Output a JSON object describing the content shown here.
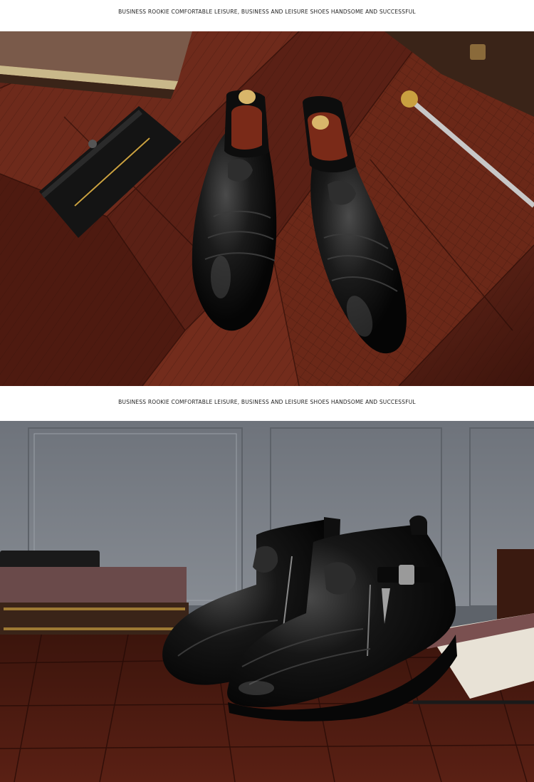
{
  "sections": [
    {
      "caption": "BUSINESS ROOKIE COMFORTABLE LEISURE, BUSINESS AND LEISURE SHOES HANDSOME AND SUCCESSFUL",
      "photo_subject": "pair of black leather zip ankle boots on parquet floor with wallet, pen and books"
    },
    {
      "caption": "BUSINESS ROOKIE COMFORTABLE LEISURE, BUSINESS AND LEISURE SHOES HANDSOME AND SUCCESSFUL",
      "photo_subject": "pair of black leather zip ankle boots with buckle strap beside stacked books"
    }
  ],
  "colors": {
    "wood_dark": "#3a140c",
    "wood_mid": "#6a2a1a",
    "leather": "#111111",
    "wall": "#7b8088"
  }
}
